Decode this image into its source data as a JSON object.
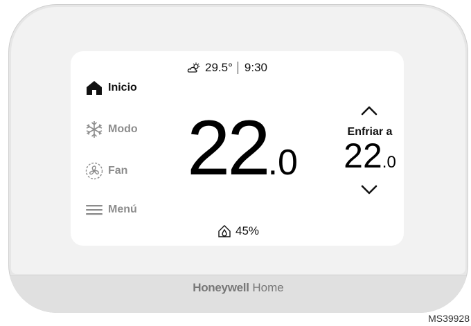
{
  "status": {
    "outdoor_temp": "29.5°",
    "time": "9:30"
  },
  "nav": [
    {
      "label": "Inicio",
      "icon": "home-icon",
      "active": true
    },
    {
      "label": "Modo",
      "icon": "snowflake-icon",
      "active": false
    },
    {
      "label": "Fan",
      "icon": "fan-icon",
      "active": false
    },
    {
      "label": "Menú",
      "icon": "menu-icon",
      "active": false
    }
  ],
  "current_temp": {
    "integer": "22",
    "decimal": ".0"
  },
  "setpoint": {
    "mode_label": "Enfriar a",
    "integer": "22",
    "decimal": ".0"
  },
  "humidity": {
    "value": "45%"
  },
  "brand": {
    "name": "Honeywell",
    "suffix": "Home"
  },
  "figure_code": "MS39928",
  "colors": {
    "active_text": "#111111",
    "inactive_text": "#8c8c8c",
    "screen_bg": "#ffffff",
    "bezel": "#f2f2f2"
  }
}
